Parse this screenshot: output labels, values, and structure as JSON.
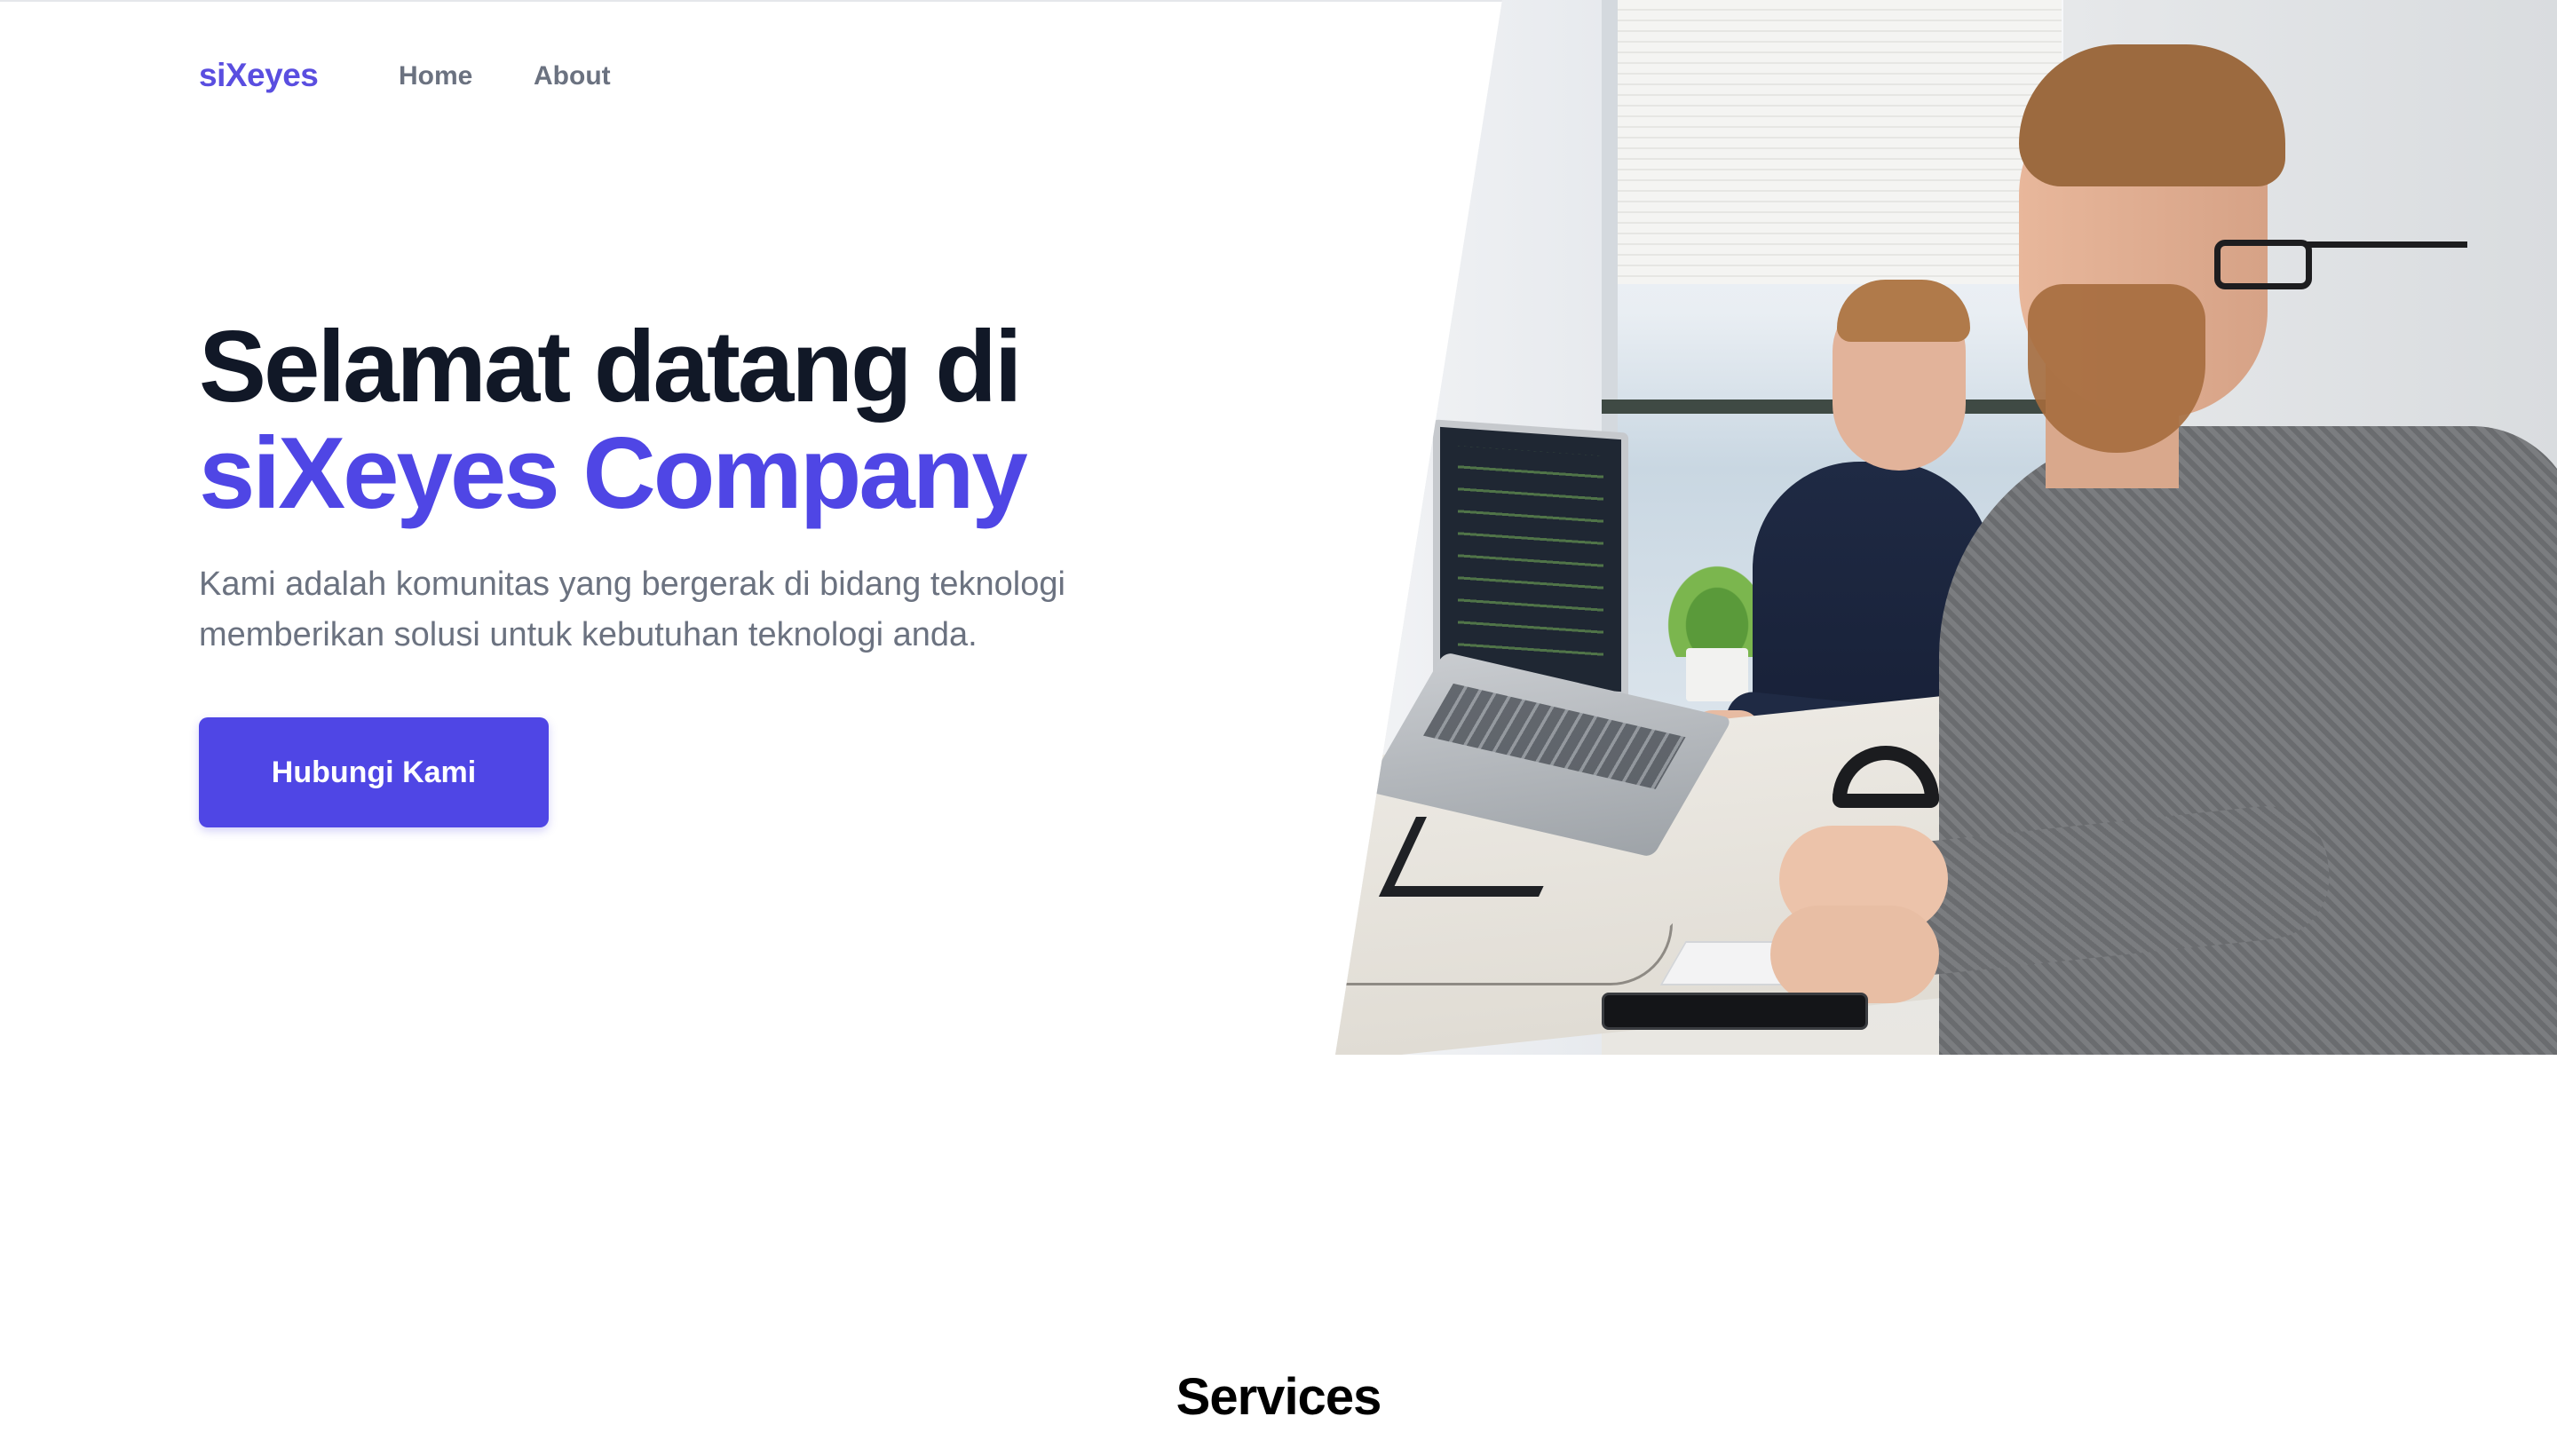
{
  "nav": {
    "logo": "siXeyes",
    "links": [
      "Home",
      "About"
    ]
  },
  "hero": {
    "title_line1": "Selamat datang di",
    "title_line2": "siXeyes Company",
    "subtitle": "Kami adalah komunitas yang bergerak di bidang teknologi memberikan solusi untuk kebutuhan teknologi anda.",
    "cta_label": "Hubungi Kami",
    "image": "office-workers-photo"
  },
  "sections": {
    "services_title": "Services"
  },
  "colors": {
    "accent": "#4f46e5",
    "heading": "#111827",
    "muted": "#6b7280"
  }
}
